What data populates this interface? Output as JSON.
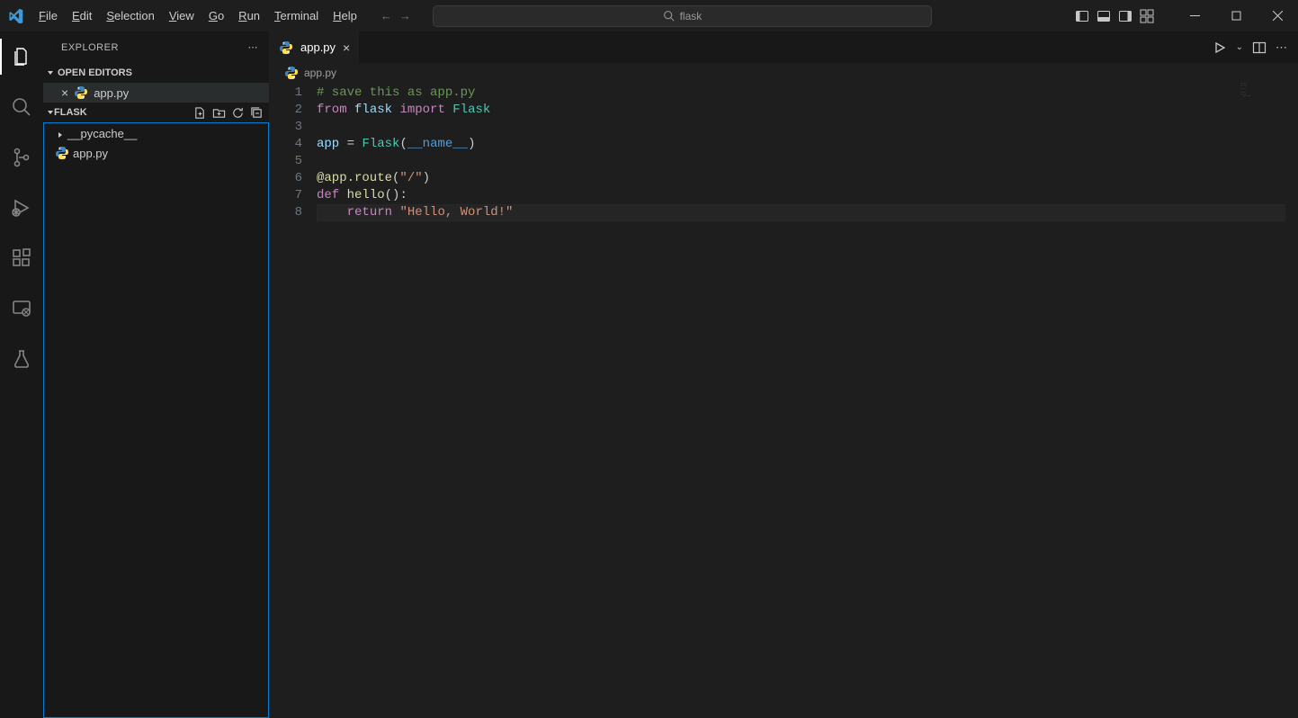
{
  "menu": {
    "items": [
      "File",
      "Edit",
      "Selection",
      "View",
      "Go",
      "Run",
      "Terminal",
      "Help"
    ]
  },
  "search": {
    "text": "flask"
  },
  "sidebar": {
    "title": "EXPLORER",
    "openEditorsLabel": "OPEN EDITORS",
    "openEditors": [
      {
        "name": "app.py"
      }
    ],
    "folderName": "FLASK",
    "tree": [
      {
        "kind": "folder",
        "name": "__pycache__",
        "expanded": false
      },
      {
        "kind": "file",
        "name": "app.py"
      }
    ]
  },
  "tabs": [
    {
      "name": "app.py",
      "active": true
    }
  ],
  "breadcrumb": {
    "file": "app.py"
  },
  "code": {
    "lines": [
      {
        "n": 1,
        "tokens": [
          {
            "t": "# save this as app.py",
            "c": "c-comment"
          }
        ]
      },
      {
        "n": 2,
        "tokens": [
          {
            "t": "from",
            "c": "c-kw"
          },
          {
            "t": " "
          },
          {
            "t": "flask",
            "c": "c-id"
          },
          {
            "t": " "
          },
          {
            "t": "import",
            "c": "c-kw"
          },
          {
            "t": " "
          },
          {
            "t": "Flask",
            "c": "c-cls"
          }
        ]
      },
      {
        "n": 3,
        "tokens": []
      },
      {
        "n": 4,
        "tokens": [
          {
            "t": "app",
            "c": "c-id"
          },
          {
            "t": " = "
          },
          {
            "t": "Flask",
            "c": "c-cls"
          },
          {
            "t": "(",
            "c": "c-punc"
          },
          {
            "t": "__name__",
            "c": "c-const"
          },
          {
            "t": ")",
            "c": "c-punc"
          }
        ]
      },
      {
        "n": 5,
        "tokens": []
      },
      {
        "n": 6,
        "tokens": [
          {
            "t": "@app.route",
            "c": "c-fn"
          },
          {
            "t": "(",
            "c": "c-punc"
          },
          {
            "t": "\"/\"",
            "c": "c-str"
          },
          {
            "t": ")",
            "c": "c-punc"
          }
        ]
      },
      {
        "n": 7,
        "tokens": [
          {
            "t": "def",
            "c": "c-kw"
          },
          {
            "t": " "
          },
          {
            "t": "hello",
            "c": "c-fn"
          },
          {
            "t": "():",
            "c": "c-punc"
          }
        ]
      },
      {
        "n": 8,
        "tokens": [
          {
            "t": "    "
          },
          {
            "t": "return",
            "c": "c-kw"
          },
          {
            "t": " "
          },
          {
            "t": "\"Hello, World!\"",
            "c": "c-str"
          }
        ],
        "current": true
      }
    ]
  }
}
